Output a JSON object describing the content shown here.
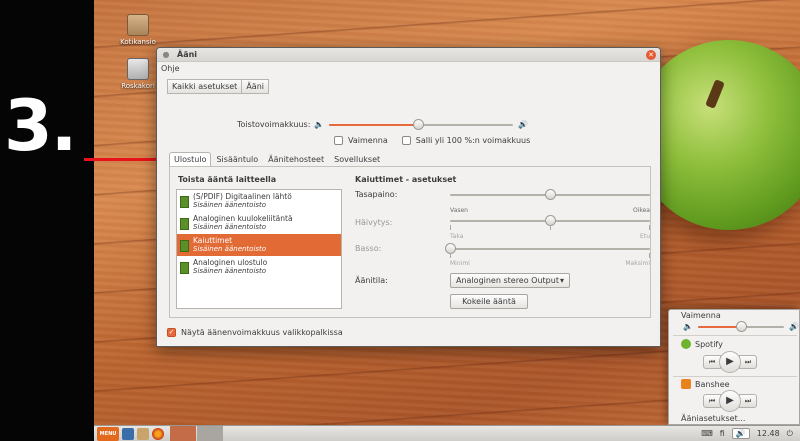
{
  "overlay": {
    "step": "3."
  },
  "desktop": {
    "icons": [
      {
        "label": "Kotikansio",
        "icon": "home-folder-icon"
      },
      {
        "label": "Roskakori",
        "icon": "trash-icon"
      }
    ]
  },
  "window": {
    "title": "Ääni",
    "menu": "Ohje",
    "breadcrumbs": [
      "Kaikki asetukset",
      "Ääni"
    ],
    "volume": {
      "label": "Toistovoimakkuus:",
      "level": 0.48
    },
    "mute_label": "Vaimenna",
    "mute_checked": false,
    "allow_over_label": "Salli yli 100 %:n voimakkuus",
    "allow_over_checked": false,
    "tabs": [
      "Ulostulo",
      "Sisääntulo",
      "Äänitehosteet",
      "Sovellukset"
    ],
    "active_tab": "Ulostulo",
    "devices_title": "Toista ääntä laitteella",
    "devices": [
      {
        "name": "(S/PDIF) Digitaalinen lähtö",
        "sub": "Sisäinen äänentoisto",
        "selected": false
      },
      {
        "name": "Analoginen kuulokeliitäntä",
        "sub": "Sisäinen äänentoisto",
        "selected": false
      },
      {
        "name": "Kaiuttimet",
        "sub": "Sisäinen äänentoisto",
        "selected": true
      },
      {
        "name": "Analoginen ulostulo",
        "sub": "Sisäinen äänentoisto",
        "selected": false
      }
    ],
    "settings": {
      "title": "Kaiuttimet - asetukset",
      "balance": {
        "label": "Tasapaino:",
        "min": "Vasen",
        "max": "Oikea",
        "level": 0.5
      },
      "fade": {
        "label": "Häivytys:",
        "min": "Taka",
        "max": "Etu",
        "level": 0.5
      },
      "bass": {
        "label": "Basso:",
        "min": "Minimi",
        "max": "Maksimi",
        "level": 0.0
      },
      "profile_label": "Äänitila:",
      "profile_value": "Analoginen stereo Output",
      "test_button": "Kokeile ääntä"
    },
    "show_in_menubar_label": "Näytä äänenvoimakkuus valikkopalkissa",
    "show_in_menubar_checked": true
  },
  "popup": {
    "mute": "Vaimenna",
    "level": 0.5,
    "players": [
      "Spotify",
      "Banshee"
    ],
    "settings": "Ääniasetukset..."
  },
  "taskbar": {
    "menu_label": "MENU",
    "keyboard_layout": "fi",
    "clock": "12.48"
  },
  "colors": {
    "accent": "#e66a3d",
    "selection": "#e26a35",
    "arrow": "#e8121a",
    "close": "#e45a33"
  }
}
